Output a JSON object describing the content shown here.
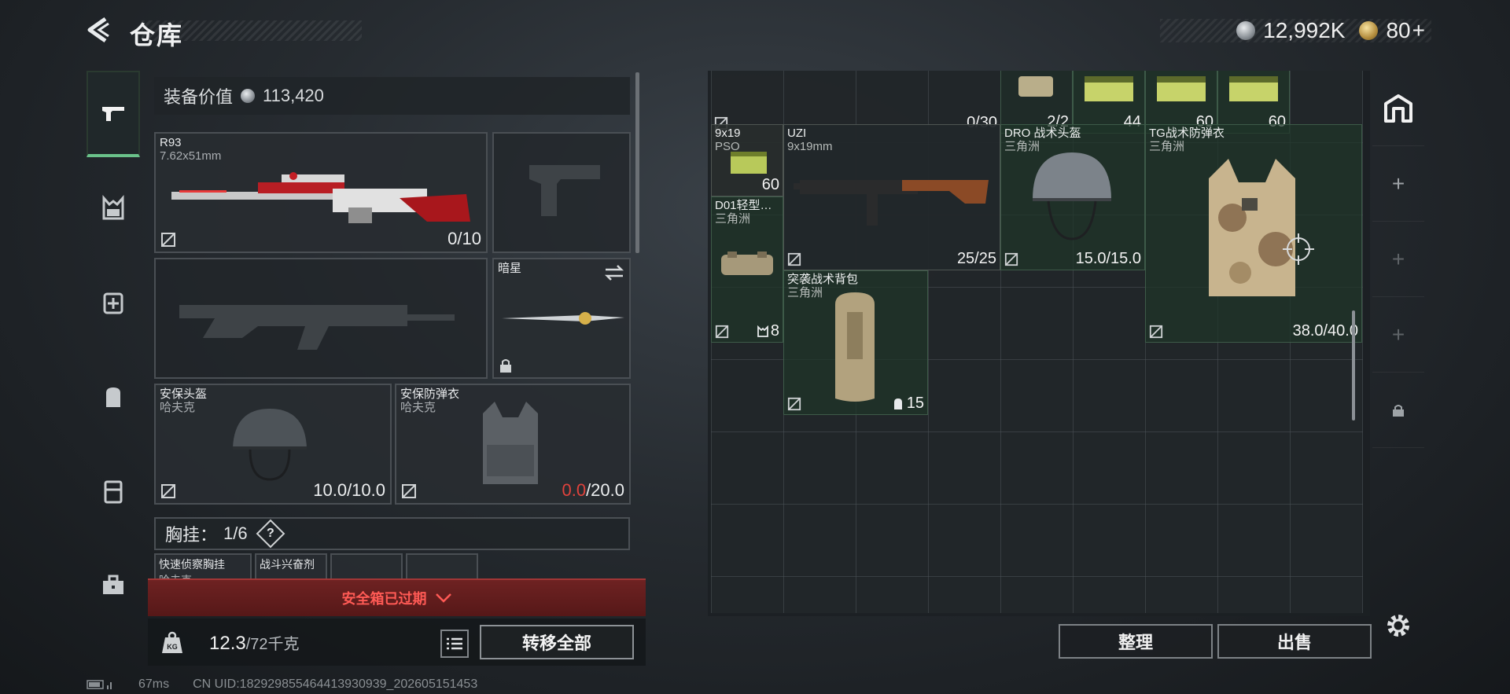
{
  "header": {
    "title": "仓库",
    "currency_primary": "12,992K",
    "currency_secondary": "80",
    "add_symbol": "+"
  },
  "equipment": {
    "value_label": "装备价值",
    "value": "113,420",
    "primary_weapon": {
      "name": "R93",
      "caliber": "7.62x51mm",
      "ammo": "0/10"
    },
    "melee": {
      "name": "暗星"
    },
    "helmet": {
      "name": "安保头盔",
      "maker": "哈夫克",
      "durability": "10.0/10.0"
    },
    "armor": {
      "name": "安保防弹衣",
      "maker": "哈夫克",
      "durability_current": "0.0",
      "durability_max": "/20.0"
    },
    "chest_rig": {
      "label": "胸挂：",
      "count": "1/6",
      "help": "?"
    },
    "rig_slots": [
      {
        "name": "快速侦察胸挂",
        "maker": "哈夫克"
      },
      {
        "name": "战斗兴奋剂"
      }
    ],
    "safe_box_status": "安全箱已过期",
    "weight": {
      "current": "12.3",
      "max": "/72千克"
    },
    "transfer_all": "转移全部"
  },
  "stash": {
    "top_row": [
      {
        "count": "0/30"
      },
      {
        "count": "2/2"
      },
      {
        "count": "44"
      },
      {
        "count": "60"
      },
      {
        "count": "60"
      }
    ],
    "items": [
      {
        "name": "9x19",
        "sub": "PSO",
        "count": "60"
      },
      {
        "name": "UZI",
        "sub": "9x19mm",
        "count": "25/25"
      },
      {
        "name": "DRO 战术头盔",
        "sub": "三角洲",
        "count": "15.0/15.0"
      },
      {
        "name": "TG战术防弹衣",
        "sub": "三角洲",
        "count": "38.0/40.0"
      },
      {
        "name": "D01轻型…",
        "sub": "三角洲",
        "count": "8"
      },
      {
        "name": "突袭战术背包",
        "sub": "三角洲",
        "count": "15"
      }
    ],
    "sort_label": "整理",
    "sell_label": "出售"
  },
  "right_tabs": [
    "+",
    "+",
    "+"
  ],
  "footer": {
    "ping": "67ms",
    "uid": "CN UID:18292985546441393093​9_202605151453"
  },
  "colors": {
    "accent_green": "#6ac28a",
    "warning_red": "#ff5a55",
    "item_green_bg": "#1e3428"
  }
}
